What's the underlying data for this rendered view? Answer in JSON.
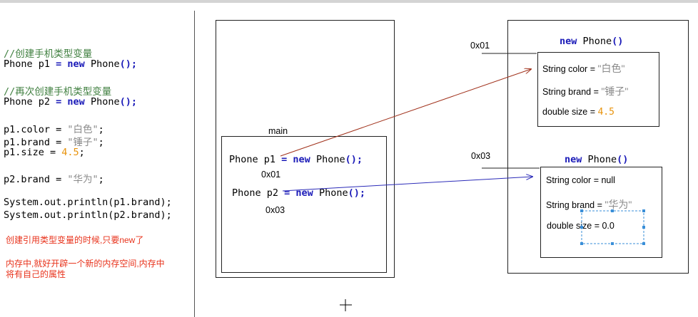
{
  "code": {
    "comment1": "//创建手机类型变量",
    "line1": {
      "type": "Phone p1 ",
      "eq": "= ",
      "kw": "new",
      "call": " Phone",
      "paren": "();"
    },
    "comment2": "//再次创建手机类型变量",
    "line2": {
      "type": "Phone p2 ",
      "eq": "= ",
      "kw": "new",
      "call": " Phone",
      "paren": "();"
    },
    "color_line": {
      "pre": "p1.color = ",
      "val": "\"白色\"",
      "end": ";"
    },
    "brand_line": {
      "pre": "p1.brand = ",
      "val": "\"锤子\"",
      "end": ";"
    },
    "size_line": {
      "pre": "p1.size = ",
      "val": "4.5",
      "end": ";"
    },
    "brand2_line": {
      "pre": "p2.brand = ",
      "val": "\"华为\"",
      "end": ";"
    },
    "print1": "System.out.println(p1.brand);",
    "print2": "System.out.println(p2.brand);"
  },
  "notes": {
    "note1": "创建引用类型变量的时候,只要new了",
    "note2_l1": "内存中,就好开辟一个新的内存空间,内存中",
    "note2_l2": "将有自己的属性"
  },
  "stack": {
    "main_label": "main",
    "p1_stmt": {
      "type": "Phone p1 ",
      "eq": "= ",
      "kw": "new",
      "call": " Phone",
      "paren": "();"
    },
    "p1_addr": "0x01",
    "p2_stmt": {
      "type": "Phone p2 ",
      "eq": "= ",
      "kw": "new",
      "call": " Phone",
      "paren": "();"
    },
    "p2_addr": "0x03"
  },
  "heap": {
    "obj1_addr": "0x01",
    "obj1_header": {
      "kw": "new",
      "call": " Phone",
      "paren": "()"
    },
    "obj1_color": {
      "pre": "String color = ",
      "val": "\"白色\""
    },
    "obj1_brand": {
      "pre": "String brand = ",
      "val": "\"锤子\""
    },
    "obj1_size": {
      "pre": "double size = ",
      "val": "4.5"
    },
    "obj2_addr": "0x03",
    "obj2_header": {
      "kw": "new",
      "call": " Phone",
      "paren": "()"
    },
    "obj2_color": "String color = null",
    "obj2_brand": {
      "pre": "String brand = ",
      "val": "\"华为\""
    },
    "obj2_size": "double size = 0.0"
  },
  "colors": {
    "comment": "#3f7f3f",
    "keyword": "#1a1ab8",
    "string": "#8a8a8a",
    "number": "#e8930c",
    "note": "#e8331c",
    "arrow1": "#a0301a",
    "arrow2": "#2a2ab8",
    "selection": "#3a8fd8"
  }
}
